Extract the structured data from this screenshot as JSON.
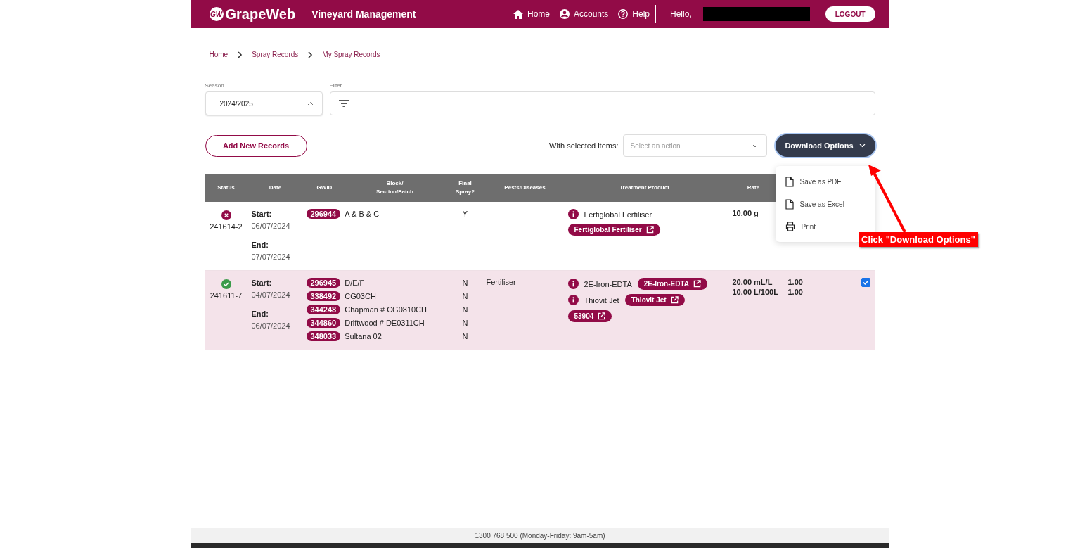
{
  "header": {
    "logo_mark": "GW",
    "logo_text": "GrapeWeb",
    "app_title": "Vineyard Management",
    "nav": [
      {
        "label": "Home",
        "kind": "home"
      },
      {
        "label": "Accounts",
        "kind": "user"
      },
      {
        "label": "Help",
        "kind": "help"
      }
    ],
    "greeting": "Hello,",
    "logout": "LOGOUT"
  },
  "breadcrumbs": [
    "Home",
    "Spray Records",
    "My Spray Records"
  ],
  "season": {
    "label": "Season",
    "value": "2024/2025"
  },
  "filter": {
    "label": "Filter"
  },
  "add_button": "Add New Records",
  "bulk": {
    "label": "With selected items:",
    "placeholder": "Select an action"
  },
  "download": {
    "label": "Download Options",
    "expanded": true,
    "items": [
      {
        "label": "Save as PDF",
        "kind": "file"
      },
      {
        "label": "Save as Excel",
        "kind": "file"
      },
      {
        "label": "Print",
        "kind": "printer"
      }
    ]
  },
  "table": {
    "columns": [
      "Status",
      "Date",
      "GWID",
      "Block/\nSection/Patch",
      "Final\nSpray?",
      "Pests/Diseases",
      "Treatment Product",
      "Rate"
    ],
    "rows": [
      {
        "kind": "error",
        "id": "241614-2",
        "start_label": "Start:",
        "start": "06/07/2024",
        "end_label": "End:",
        "end": "07/07/2024",
        "blocks": [
          {
            "gwid": "296944",
            "name": "A & B & C",
            "final": "Y"
          }
        ],
        "treatment": [
          {
            "name": "Fertiglobal Fertiliser"
          },
          {
            "link": "Fertiglobal Fertiliser"
          }
        ],
        "rate": [
          "10.00 g"
        ],
        "selected": false
      },
      {
        "kind": "ok",
        "id": "241611-7",
        "start_label": "Start:",
        "start": "04/07/2024",
        "end_label": "End:",
        "end": "06/07/2024",
        "blocks": [
          {
            "gwid": "296945",
            "name": "D/E/F",
            "final": "N"
          },
          {
            "gwid": "338492",
            "name": "CG03CH",
            "final": "N"
          },
          {
            "gwid": "344248",
            "name": "Chapman # CG0810CH",
            "final": "N"
          },
          {
            "gwid": "344860",
            "name": "Driftwood # DE0311CH",
            "final": "N"
          },
          {
            "gwid": "348033",
            "name": "Sultana 02",
            "final": "N"
          }
        ],
        "pests": "Fertiliser",
        "treatment": [
          {
            "name": "2E-Iron-EDTA",
            "link": "2E-Iron-EDTA"
          },
          {
            "name": "Thiovit Jet",
            "link": "Thiovit Jet"
          },
          {
            "link": "53904"
          }
        ],
        "rate": [
          "20.00 mL/L",
          "10.00 L/100L"
        ],
        "column_9": [
          "1.00",
          "1.00"
        ],
        "selected": true
      }
    ]
  },
  "annotation": {
    "text": "Click \"Download Options\""
  },
  "footer": "1300 768 500 (Monday-Friday: 9am-5am)"
}
